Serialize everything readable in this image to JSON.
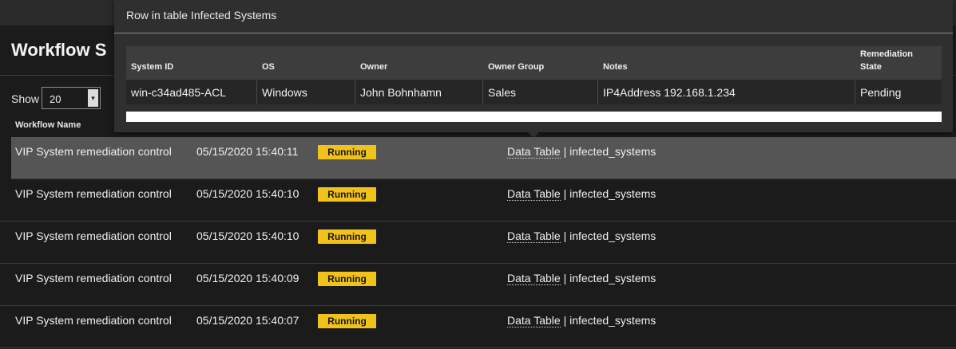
{
  "page": {
    "title": "Workflow S"
  },
  "pagination": {
    "show_label": "Show",
    "page_size": "20"
  },
  "table": {
    "column_header": "Workflow Name",
    "rows": [
      {
        "name": "VIP System remediation control",
        "date": "05/15/2020 15:40:11",
        "status": "Running",
        "link": "Data Table",
        "target": " | infected_systems"
      },
      {
        "name": "VIP System remediation control",
        "date": "05/15/2020 15:40:10",
        "status": "Running",
        "link": "Data Table",
        "target": " | infected_systems"
      },
      {
        "name": "VIP System remediation control",
        "date": "05/15/2020 15:40:10",
        "status": "Running",
        "link": "Data Table",
        "target": " | infected_systems"
      },
      {
        "name": "VIP System remediation control",
        "date": "05/15/2020 15:40:09",
        "status": "Running",
        "link": "Data Table",
        "target": " | infected_systems"
      },
      {
        "name": "VIP System remediation control",
        "date": "05/15/2020 15:40:07",
        "status": "Running",
        "link": "Data Table",
        "target": " | infected_systems"
      }
    ]
  },
  "popover": {
    "title": "Row in table Infected Systems",
    "headers": {
      "system_id": "System ID",
      "os": "OS",
      "owner": "Owner",
      "owner_group": "Owner Group",
      "notes": "Notes",
      "remediation_line1": "Remediation",
      "remediation_line2": "State"
    },
    "row": {
      "system_id": "win-c34ad485-ACL",
      "os": "Windows",
      "owner": "John Bohnhamn",
      "owner_group": "Sales",
      "notes": "IP4Address 192.168.1.234",
      "remediation": "Pending"
    }
  },
  "colors": {
    "status_running": "#f1c21b",
    "highlight_row": "#555555",
    "background": "#1b1b1b"
  },
  "icons": {
    "select_arrow": "chevron-down-icon"
  }
}
